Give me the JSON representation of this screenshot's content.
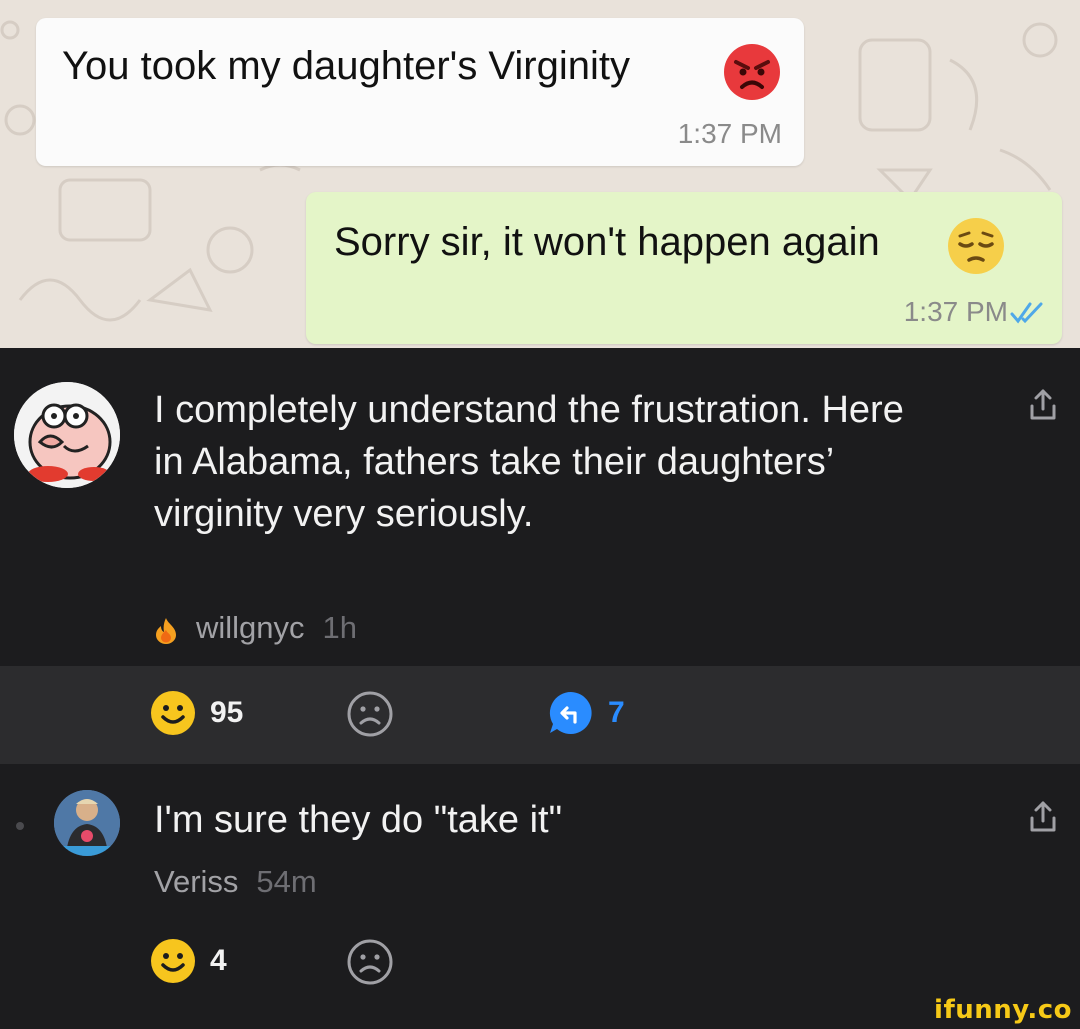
{
  "chat": {
    "incoming": {
      "text": "You took my daughter's Virginity",
      "time": "1:37 PM",
      "emoji": "angry-face-icon"
    },
    "outgoing": {
      "text": "Sorry sir, it won't happen again",
      "time": "1:37 PM",
      "emoji": "pensive-face-icon",
      "status": "read-ticks-icon"
    }
  },
  "comments": [
    {
      "text": "I completely understand the frustration. Here in Alabama, fathers take their daughters’ virginity very seriously.",
      "author": "willgnyc",
      "age": "1h",
      "smiles": "95",
      "replies": "7"
    },
    {
      "text": "I'm sure they do \"take it\"",
      "author": "Veriss",
      "age": "54m",
      "smiles": "4"
    }
  ],
  "watermark": "ifunny.co",
  "colors": {
    "chat_bg": "#e9e2da",
    "incoming_bubble": "#fbfbfb",
    "outgoing_bubble": "#e4f5c8",
    "dark_bg": "#1c1c1e",
    "action_bar_bg": "#2c2c2e",
    "smile_yellow": "#f7c51e",
    "reply_blue": "#2a8cff",
    "read_ticks": "#4fa8e8",
    "watermark": "#f6c917"
  }
}
